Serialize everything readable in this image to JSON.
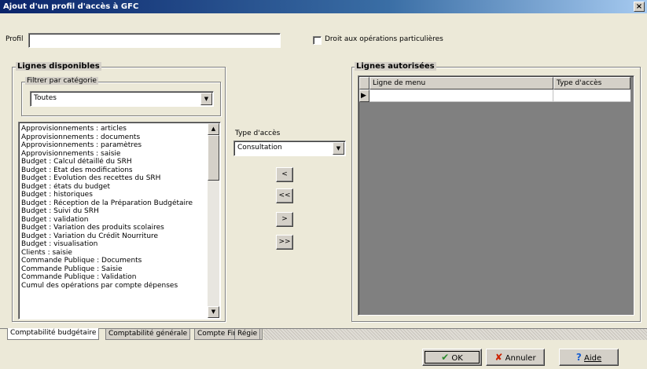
{
  "window": {
    "title": "Ajout d'un profil d'accès à GFC",
    "close_glyph": "×"
  },
  "profil": {
    "label": "Profil",
    "value": ""
  },
  "droit": {
    "label": "Droit aux opérations particulières",
    "checked": false
  },
  "lignes_disponibles": {
    "title": "Lignes disponibles",
    "filter_title": "Filtrer par catégorie",
    "filter_value": "Toutes",
    "items": [
      "Approvisionnements : articles",
      "Approvisionnements : documents",
      "Approvisionnements : paramètres",
      "Approvisionnements : saisie",
      "Budget : Calcul détaillé du SRH",
      "Budget : Etat des modifications",
      "Budget : Evolution des recettes du SRH",
      "Budget : états du budget",
      "Budget : historiques",
      "Budget : Réception de la Préparation Budgétaire",
      "Budget : Suivi du SRH",
      "Budget : validation",
      "Budget : Variation des produits scolaires",
      "Budget : Variation du Crédit Nourriture",
      "Budget : visualisation",
      "Clients : saisie",
      "Commande Publique : Documents",
      "Commande Publique : Saisie",
      "Commande Publique : Validation",
      "Cumul des opérations par compte dépenses"
    ]
  },
  "type_acces": {
    "label": "Type d'accès",
    "value": "Consultation"
  },
  "move_buttons": {
    "left_one": "<",
    "left_all": "<<",
    "right_one": ">",
    "right_all": ">>"
  },
  "lignes_autorisees": {
    "title": "Lignes autorisées",
    "columns": [
      "Ligne de menu",
      "Type d'accès"
    ],
    "row_indicator": "▶"
  },
  "tabs": [
    "Comptabilité budgétaire",
    "Comptabilité générale",
    "Compte Financier",
    "Régie"
  ],
  "buttons": {
    "ok": "OK",
    "annuler": "Annuler",
    "aide": "Aide"
  },
  "icons": {
    "ok": "check-icon",
    "annuler": "x-icon",
    "aide": "question-icon",
    "dropdown": "chevron-down-icon"
  },
  "colors": {
    "titlebar": "#0a246a",
    "ok_check": "#2e8b2e",
    "annuler_x": "#cc2200",
    "aide_q": "#1a5fd0"
  }
}
